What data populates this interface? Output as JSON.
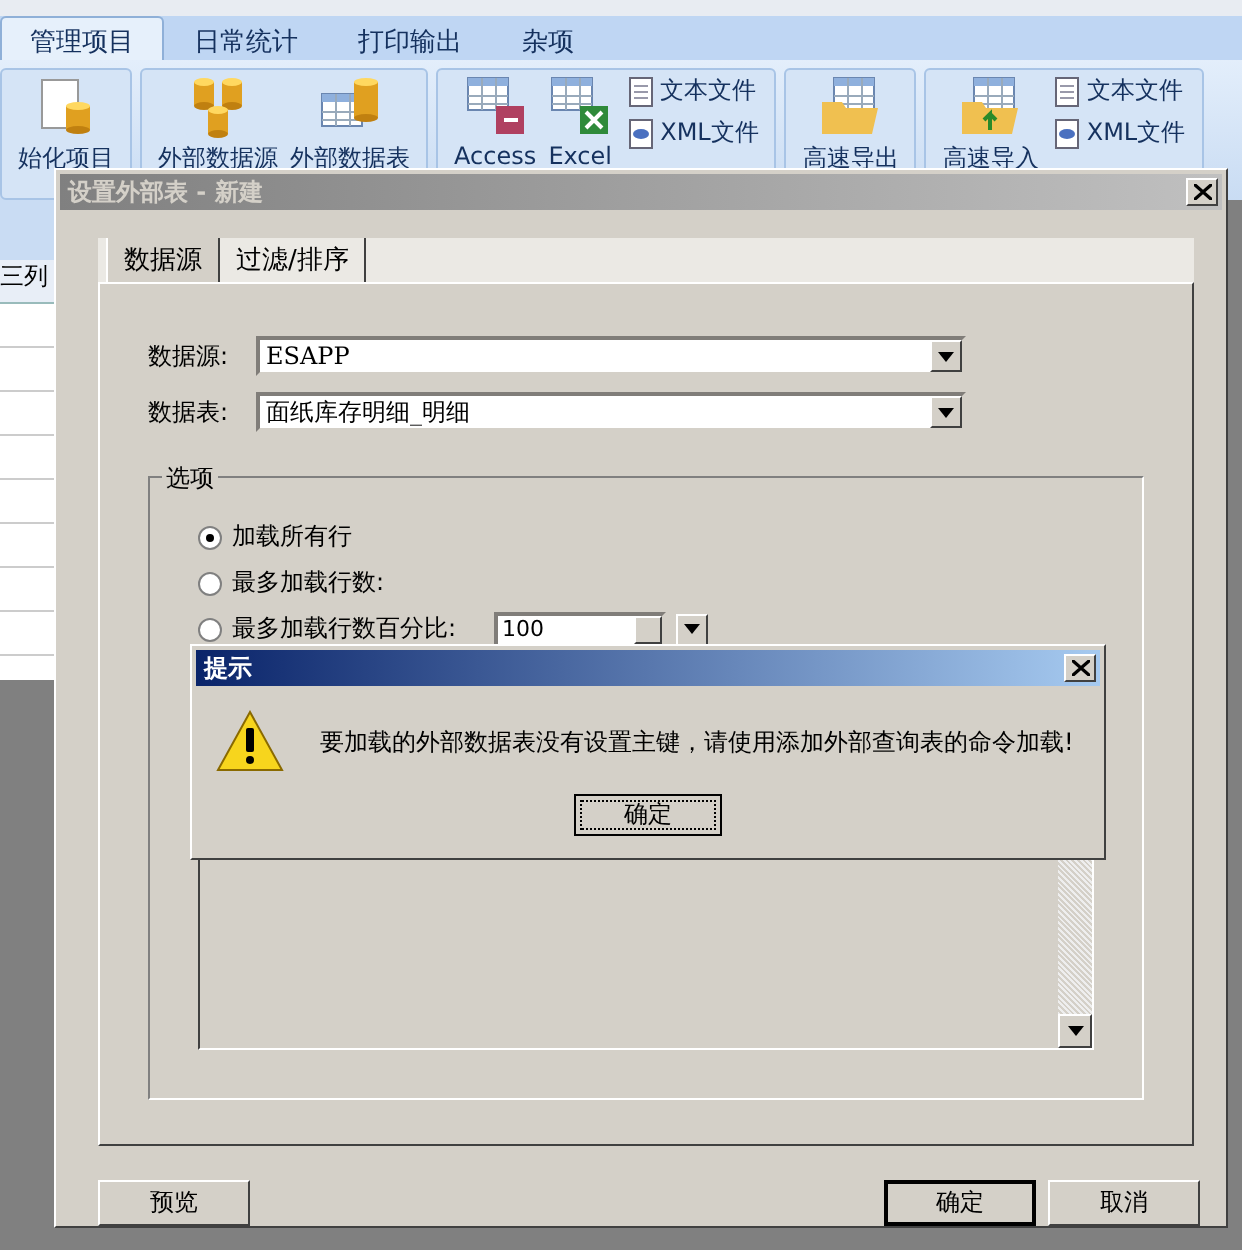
{
  "ribbon": {
    "tabs": [
      {
        "label": "管理项目",
        "selected": true
      },
      {
        "label": "日常统计",
        "selected": false
      },
      {
        "label": "打印输出",
        "selected": false
      },
      {
        "label": "杂项",
        "selected": false
      }
    ],
    "groups": [
      {
        "items": [
          {
            "label": "始化项目",
            "kind": "large"
          }
        ]
      },
      {
        "items": [
          {
            "label": "外部数据源",
            "kind": "large"
          },
          {
            "label": "外部数据表",
            "kind": "large"
          }
        ]
      },
      {
        "items": [
          {
            "label": "Access",
            "kind": "large"
          },
          {
            "label": "Excel",
            "kind": "large"
          },
          {
            "label": "文本文件",
            "kind": "small"
          },
          {
            "label": "XML文件",
            "kind": "small"
          }
        ]
      },
      {
        "items": [
          {
            "label": "高速导出",
            "kind": "large"
          }
        ]
      },
      {
        "items": [
          {
            "label": "高速导入",
            "kind": "large"
          },
          {
            "label": "文本文件",
            "kind": "small"
          },
          {
            "label": "XML文件",
            "kind": "small"
          }
        ]
      }
    ]
  },
  "grid": {
    "header": "三列"
  },
  "dialog": {
    "title": "设置外部表 - 新建",
    "tabs": [
      {
        "label": "数据源",
        "selected": true
      },
      {
        "label": "过滤/排序",
        "selected": false
      }
    ],
    "fields": [
      {
        "label": "数据源:",
        "value": "ESAPP"
      },
      {
        "label": "数据表:",
        "value": "面纸库存明细_明细"
      }
    ],
    "options": {
      "title": "选项",
      "radios": [
        {
          "label": "加载所有行",
          "selected": true
        },
        {
          "label": "最多加载行数:",
          "selected": false
        },
        {
          "label": "最多加载行数百分比:",
          "selected": false
        }
      ],
      "percent": "100"
    },
    "buttons": [
      {
        "label": "预览",
        "default": false
      },
      {
        "label": "确定",
        "default": true
      },
      {
        "label": "取消",
        "default": false
      }
    ]
  },
  "message": {
    "title": "提示",
    "text": "要加载的外部数据表没有设置主键，请使用添加外部查询表的命令加载!",
    "button": "确定"
  }
}
